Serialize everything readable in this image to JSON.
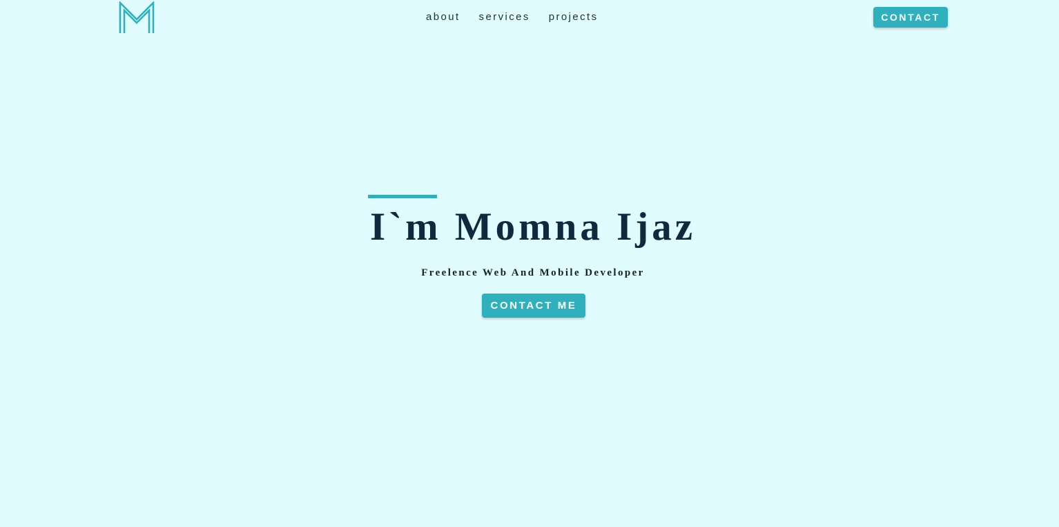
{
  "header": {
    "logo_icon": "m-monogram-logo",
    "nav_items": [
      {
        "label": "about"
      },
      {
        "label": "services"
      },
      {
        "label": "projects"
      }
    ],
    "contact_label": "CONTACT"
  },
  "hero": {
    "title": "I`m Momna Ijaz",
    "subtitle": "Freelence Web And Mobile Developer",
    "cta_label": "CONTACT ME"
  },
  "colors": {
    "background": "#e0fcfe",
    "accent": "#2eb1bd",
    "heading": "#0f2a3d"
  }
}
